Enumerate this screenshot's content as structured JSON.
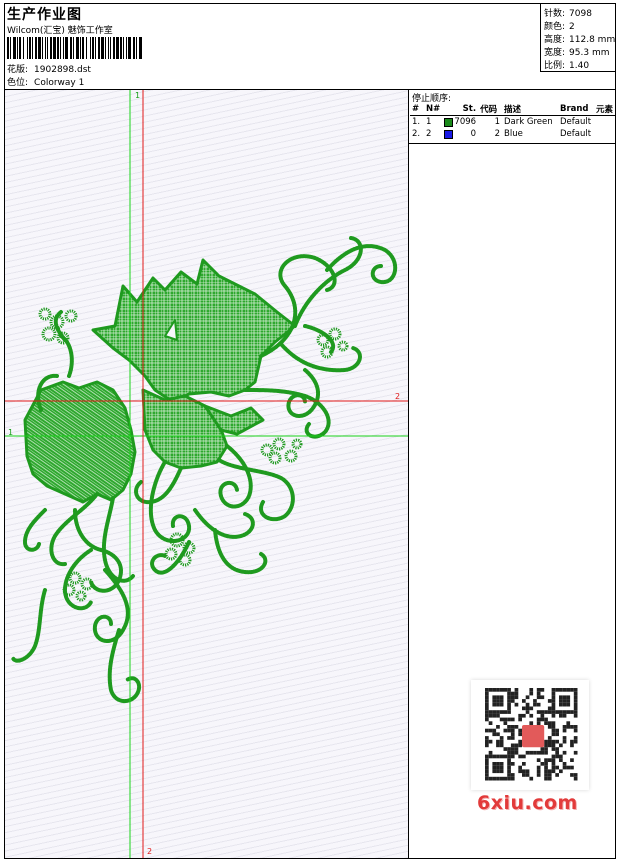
{
  "header": {
    "title": "生产作业图",
    "company": "Wilcom(汇宝) 魅饰工作室",
    "design_label": "花版:",
    "design_value": "1902898.dst",
    "colorway_label": "色位:",
    "colorway_value": "Colorway 1"
  },
  "info": [
    {
      "label": "针数:",
      "value": "7098"
    },
    {
      "label": "颜色:",
      "value": "2"
    },
    {
      "label": "高度:",
      "value": "112.8 mm"
    },
    {
      "label": "宽度:",
      "value": "95.3 mm"
    },
    {
      "label": "比例:",
      "value": "1.40"
    }
  ],
  "stops": {
    "title": "停止顺序:",
    "headers": [
      "#",
      "N#",
      "St.",
      "代码",
      "描述",
      "Brand",
      "元素"
    ],
    "rows": [
      {
        "idx": "1.",
        "n": "1",
        "st": "7096",
        "code": "1",
        "desc": "Dark Green",
        "brand": "Default",
        "color": "#1a8a1a"
      },
      {
        "idx": "2.",
        "n": "2",
        "st": "0",
        "code": "2",
        "desc": "Blue",
        "brand": "Default",
        "color": "#1a1ae6"
      }
    ]
  },
  "markers": {
    "green_v": "1",
    "green_h": "1",
    "red_h": "2",
    "red_v": "2"
  },
  "colors": {
    "thread_green": "#1f9a1f",
    "marker_green": "#19d219",
    "marker_red": "#e01818"
  },
  "watermark": "6xiu.com"
}
